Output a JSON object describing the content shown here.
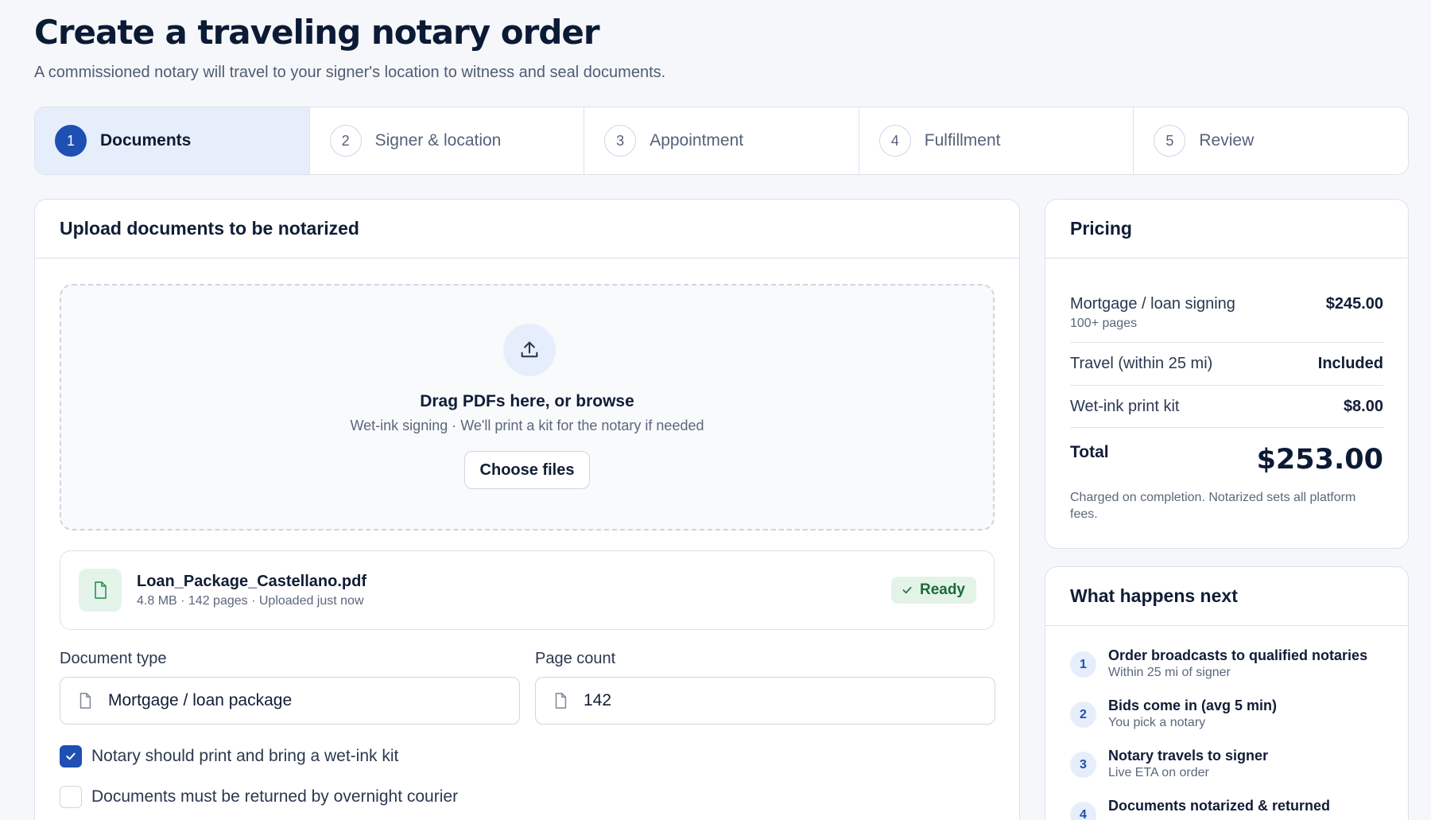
{
  "header": {
    "title": "Create a traveling notary order",
    "subtitle": "A commissioned notary will travel to your signer's location to witness and seal documents."
  },
  "steps": [
    {
      "num": "1",
      "label": "Documents",
      "active": true
    },
    {
      "num": "2",
      "label": "Signer & location",
      "active": false
    },
    {
      "num": "3",
      "label": "Appointment",
      "active": false
    },
    {
      "num": "4",
      "label": "Fulfillment",
      "active": false
    },
    {
      "num": "5",
      "label": "Review",
      "active": false
    }
  ],
  "upload": {
    "heading": "Upload documents to be notarized",
    "drop_title": "Drag PDFs here, or browse",
    "drop_sub": "Wet-ink signing · We'll print a kit for the notary if needed",
    "choose_label": "Choose files",
    "icon": "upload-icon"
  },
  "file": {
    "name": "Loan_Package_Castellano.pdf",
    "meta": "4.8 MB · 142 pages · Uploaded just now",
    "status": "Ready",
    "icon": "file-icon"
  },
  "fields": {
    "doc_type_label": "Document type",
    "doc_type_value": "Mortgage / loan package",
    "page_count_label": "Page count",
    "page_count_value": "142"
  },
  "checks": [
    {
      "label": "Notary should print and bring a wet-ink kit",
      "checked": true
    },
    {
      "label": "Documents must be returned by overnight courier",
      "checked": false
    }
  ],
  "pricing": {
    "heading": "Pricing",
    "rows": [
      {
        "name": "Mortgage / loan signing",
        "note": "100+ pages",
        "value": "$245.00"
      },
      {
        "name": "Travel (within 25 mi)",
        "note": "",
        "value": "Included"
      },
      {
        "name": "Wet-ink print kit",
        "note": "",
        "value": "$8.00"
      }
    ],
    "total_label": "Total",
    "total_value": "$253.00",
    "note": "Charged on completion. Notarized sets all platform fees."
  },
  "next": {
    "heading": "What happens next",
    "items": [
      {
        "num": "1",
        "title": "Order broadcasts to qualified notaries",
        "sub": "Within 25 mi of signer"
      },
      {
        "num": "2",
        "title": "Bids come in (avg 5 min)",
        "sub": "You pick a notary"
      },
      {
        "num": "3",
        "title": "Notary travels to signer",
        "sub": "Live ETA on order"
      },
      {
        "num": "4",
        "title": "Documents notarized & returned",
        "sub": ""
      }
    ]
  },
  "colors": {
    "accent": "#1e4fb3",
    "active_step_bg": "#e6eefb",
    "success": "#1a6a3a",
    "success_bg": "#e3f3e8",
    "page_bg": "#f5f7fb"
  }
}
